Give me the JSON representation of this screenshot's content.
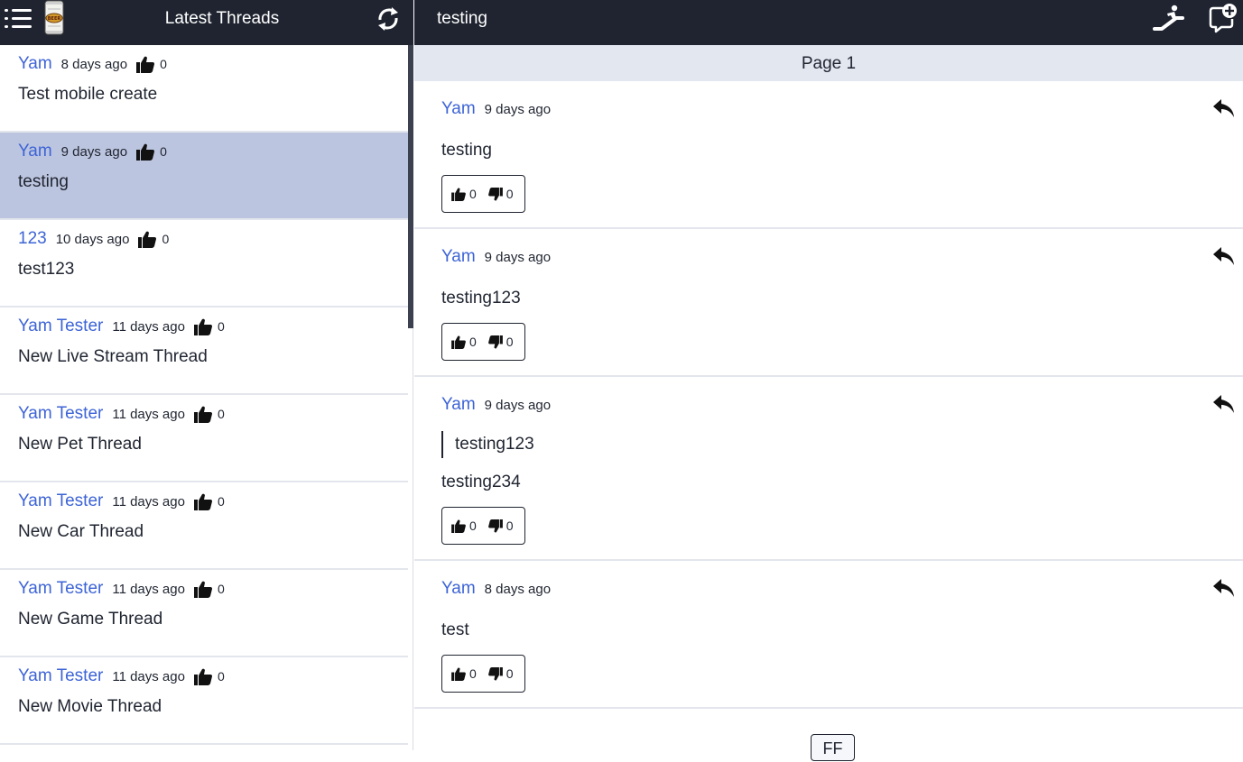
{
  "sidebar": {
    "title": "Latest Threads",
    "logo_text": "BEER",
    "threads": [
      {
        "author": "Yam",
        "time": "8 days ago",
        "likes": "0",
        "title": "Test mobile create",
        "selected": false
      },
      {
        "author": "Yam",
        "time": "9 days ago",
        "likes": "0",
        "title": "testing",
        "selected": true
      },
      {
        "author": "123",
        "time": "10 days ago",
        "likes": "0",
        "title": "test123",
        "selected": false
      },
      {
        "author": "Yam Tester",
        "time": "11 days ago",
        "likes": "0",
        "title": "New Live Stream Thread",
        "selected": false
      },
      {
        "author": "Yam Tester",
        "time": "11 days ago",
        "likes": "0",
        "title": "New Pet Thread",
        "selected": false
      },
      {
        "author": "Yam Tester",
        "time": "11 days ago",
        "likes": "0",
        "title": "New Car Thread",
        "selected": false
      },
      {
        "author": "Yam Tester",
        "time": "11 days ago",
        "likes": "0",
        "title": "New Game Thread",
        "selected": false
      },
      {
        "author": "Yam Tester",
        "time": "11 days ago",
        "likes": "0",
        "title": "New Movie Thread",
        "selected": false
      }
    ]
  },
  "thread_view": {
    "title": "testing",
    "page_label": "Page 1",
    "posts": [
      {
        "author": "Yam",
        "time": "9 days ago",
        "body": "testing",
        "quote": "",
        "upvotes": "0",
        "downvotes": "0"
      },
      {
        "author": "Yam",
        "time": "9 days ago",
        "body": "testing123",
        "quote": "",
        "upvotes": "0",
        "downvotes": "0"
      },
      {
        "author": "Yam",
        "time": "9 days ago",
        "body": "testing234",
        "quote": "testing123",
        "upvotes": "0",
        "downvotes": "0"
      },
      {
        "author": "Yam",
        "time": "8 days ago",
        "body": "test",
        "quote": "",
        "upvotes": "0",
        "downvotes": "0"
      }
    ],
    "pager_label": "FF"
  },
  "colors": {
    "topbar": "#1f2430",
    "author_link": "#3d64d6",
    "selected_thread": "#bcc5df",
    "page_bar": "#e2e7f0"
  },
  "icons": {
    "menu": "hamburger-menu-icon",
    "refresh": "refresh-icon",
    "skip_to_bottom": "escalator-icon",
    "new_post": "add-comment-icon",
    "reply": "reply-icon",
    "like": "thumbs-up-icon",
    "dislike": "thumbs-down-icon"
  }
}
